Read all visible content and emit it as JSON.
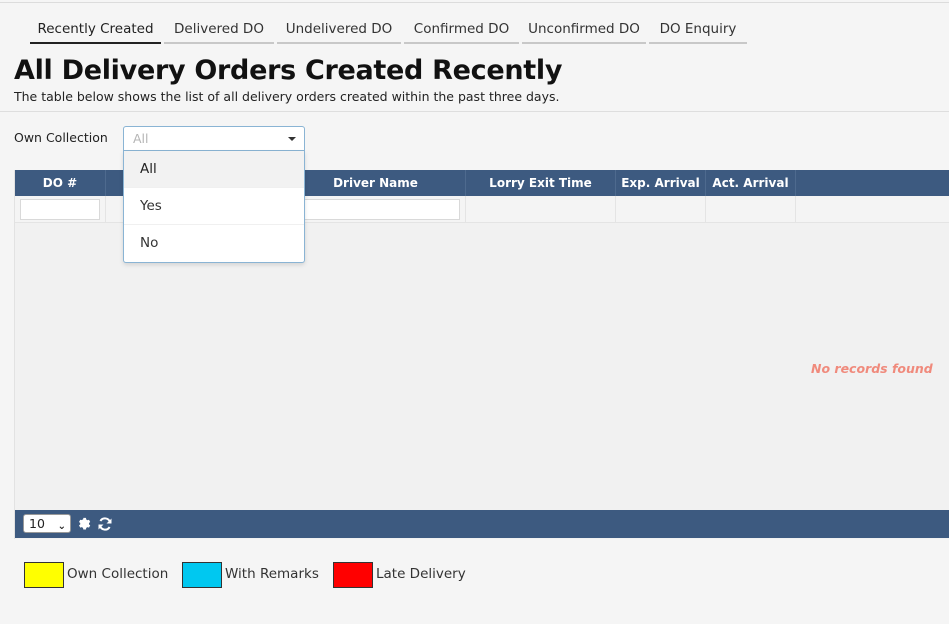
{
  "tabs": [
    {
      "label": "Recently Created",
      "active": true
    },
    {
      "label": "Delivered DO",
      "active": false
    },
    {
      "label": "Undelivered DO",
      "active": false
    },
    {
      "label": "Confirmed DO",
      "active": false
    },
    {
      "label": "Unconfirmed DO",
      "active": false
    },
    {
      "label": "DO Enquiry",
      "active": false
    }
  ],
  "page": {
    "title": "All Delivery Orders Created Recently",
    "subtitle": "The table below shows the list of all delivery orders created within the past three days."
  },
  "filter": {
    "label": "Own Collection",
    "selected": "All",
    "options": [
      "All",
      "Yes",
      "No"
    ]
  },
  "grid": {
    "columns": [
      "DO #",
      "",
      "Driver Name",
      "Lorry Exit Time",
      "Exp. Arrival",
      "Act. Arrival",
      ""
    ],
    "empty_message": "No records found",
    "page_size": "10"
  },
  "legend": [
    {
      "label": "Own Collection",
      "color": "#ffff00"
    },
    {
      "label": "With Remarks",
      "color": "#00c8f0"
    },
    {
      "label": "Late Delivery",
      "color": "#ff0000"
    }
  ],
  "colors": {
    "header": "#3d5a80",
    "accent_border": "#8ab4d4",
    "empty_text": "#f08a7c"
  }
}
